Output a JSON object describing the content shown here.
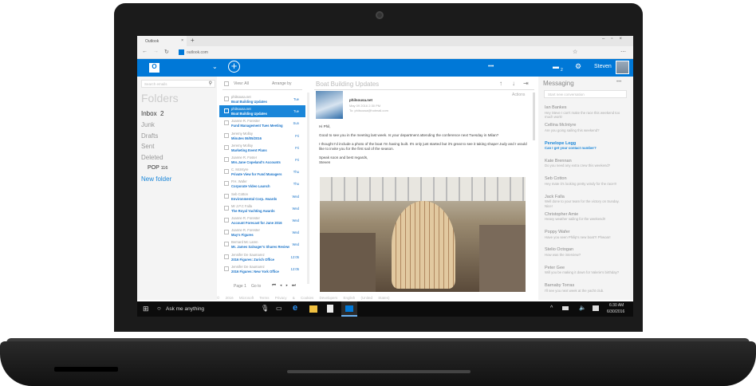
{
  "browser": {
    "tab_title": "Outlook",
    "url": "outlook.com"
  },
  "header": {
    "compose_icon": "plus-circle-icon",
    "more": "•••",
    "chat_count": "2",
    "user": "Steven"
  },
  "folders": {
    "search_placeholder": "Search emails",
    "title": "Folders",
    "inbox": "Inbox",
    "inbox_count": "2",
    "items": [
      "Junk",
      "Drafts",
      "Sent",
      "Deleted"
    ],
    "pop": "POP",
    "pop_count": "116",
    "new_folder": "New folder"
  },
  "list": {
    "view": "View: All",
    "arrange": "Arrange by",
    "page": "Page 1",
    "goto": "Go to",
    "items": [
      {
        "from": "philsousa.net",
        "subject": "Boat Building Updates",
        "date": "Tue"
      },
      {
        "from": "philsousa.net",
        "subject": "Boat Building Updates",
        "date": "Tue",
        "selected": true
      },
      {
        "from": "Joanne R. Forester",
        "subject": "Fund Management Tues Meeting",
        "date": "Sun"
      },
      {
        "from": "Jeremy Molloy",
        "subject": "Minutes 06/05/2016",
        "date": "Fri"
      },
      {
        "from": "Jeremy Molloy",
        "subject": "Marketing Event Plans",
        "date": "Fri"
      },
      {
        "from": "Joanne R. Foster",
        "subject": "Mrs.Jane Copeland's Accounts",
        "date": "Fri"
      },
      {
        "from": "C. McIntyre",
        "subject": "Private View for Fund Managers",
        "date": "Thu"
      },
      {
        "from": "P.H. Wafer",
        "subject": "Corporate Video Launch",
        "date": "Thu"
      },
      {
        "from": "Seb Cotton",
        "subject": "Environmental Corp. Awards",
        "date": "Wed"
      },
      {
        "from": "Mr J.P.C Falla",
        "subject": "The Royal Yachting Awards",
        "date": "Wed"
      },
      {
        "from": "Joanne R. Forester",
        "subject": "Account Forecast for June 2016",
        "date": "Wed"
      },
      {
        "from": "Joanne R. Forester",
        "subject": "May's Figures",
        "date": "Wed"
      },
      {
        "from": "Bernard Mc Laren",
        "subject": "Mr. James Salvager's Shares Review",
        "date": "Wed"
      },
      {
        "from": "Jennifer De Saumarez",
        "subject": "2016 Figures: Zurich Office",
        "date": "12:05"
      },
      {
        "from": "Jennifer De Saumarez",
        "subject": "2016 Figures: New York Office",
        "date": "12:05"
      }
    ]
  },
  "reading": {
    "title": "Boat Building Updates",
    "actions": "Actions",
    "sender": "philsousa.net",
    "sent": "May 09 2016 2:30 PM",
    "to": "To: philsousa@hotmail.com",
    "body": [
      "Hi Phil,",
      "Good to see you in the meeting last week. Is your department attending the conference next Tuesday in Milan?",
      "I thought I'd include a photo of the boat I'm having built. It's only just started but it's great to see it taking shape! Judy and I would like to invite you for the first sail of the season.",
      "Speak soon and best regards,",
      "Steven"
    ]
  },
  "messaging": {
    "title": "Messaging",
    "more": "•••",
    "placeholder": "Start new conversation",
    "items": [
      {
        "name": "Ian Bankes",
        "text": "Hey Steve I can't make the race this weekend too much work!"
      },
      {
        "name": "Cellina McIntyre",
        "text": "Are you going sailing this weekend?"
      },
      {
        "name": "Penelope Legg",
        "text": "Can I get your contact number?",
        "highlight": true
      },
      {
        "name": "Kate Brennan",
        "text": "Do you need any extra crew this weekend?"
      },
      {
        "name": "Seb Cotton",
        "text": "Hey mate it's looking pretty windy for the race!!!"
      },
      {
        "name": "Jack Falla",
        "text": "Well done to your team for the victory on Sunday. Nice!"
      },
      {
        "name": "Christopher Amie",
        "text": "Heavy weather sailing for the weekend!!"
      },
      {
        "name": "Poppy Wafer",
        "text": "Have you seen Philip's new boat?! Phwoar!"
      },
      {
        "name": "Stelio Octogan",
        "text": "How was the interview?"
      },
      {
        "name": "Peter Gee",
        "text": "Will you be making it down for Valerie's birthday?"
      },
      {
        "name": "Barnaby Torras",
        "text": "I'll see you next week at the yacht club."
      }
    ]
  },
  "footer": "© 2016 Microsoft   Terms   Privacy & Cookies   Developers   English (United States)",
  "taskbar": {
    "search": "Ask me anything",
    "time": "6:30 AM",
    "date": "6/30/2016"
  },
  "colors": {
    "accent": "#0078d7"
  }
}
